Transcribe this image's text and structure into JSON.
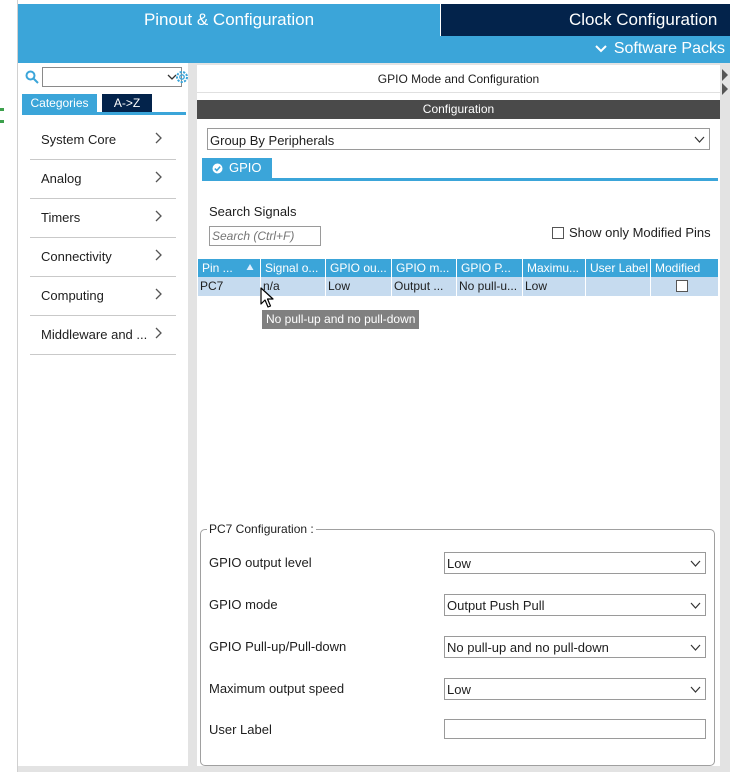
{
  "top_tabs": {
    "pinout_label": "Pinout & Configuration",
    "clock_label": "Clock Configuration",
    "software_packs": "Software Packs"
  },
  "left": {
    "search_placeholder": "",
    "tab_categories": "Categories",
    "tab_az": "A->Z",
    "categories": [
      {
        "label": "System Core"
      },
      {
        "label": "Analog"
      },
      {
        "label": "Timers"
      },
      {
        "label": "Connectivity"
      },
      {
        "label": "Computing"
      },
      {
        "label": "Middleware and ..."
      }
    ]
  },
  "main": {
    "title": "GPIO Mode and Configuration",
    "config_bar": "Configuration",
    "group_by": "Group By Peripherals",
    "gpio_tab": "GPIO",
    "search_label": "Search Signals",
    "search_placeholder": "Search (Ctrl+F)",
    "show_modified": "Show only Modified Pins",
    "table": {
      "headers": [
        "Pin ...",
        "Signal o...",
        "GPIO ou...",
        "GPIO m...",
        "GPIO P...",
        "Maximu...",
        "User Label",
        "Modified"
      ],
      "rows": [
        [
          "PC7",
          "n/a",
          "Low",
          "Output ...",
          "No pull-u...",
          "Low",
          "",
          ""
        ]
      ]
    },
    "tooltip": "No pull-up and no pull-down",
    "pc7_config": {
      "legend": "PC7 Configuration :",
      "fields": [
        {
          "label": "GPIO output level",
          "value": "Low"
        },
        {
          "label": "GPIO mode",
          "value": "Output Push Pull"
        },
        {
          "label": "GPIO Pull-up/Pull-down",
          "value": "No pull-up and no pull-down"
        },
        {
          "label": "Maximum output speed",
          "value": "Low"
        },
        {
          "label": "User Label",
          "value": ""
        }
      ]
    }
  },
  "colors": {
    "accent": "#3ba5d9",
    "dark_navy": "#03234b",
    "row_selected": "#c6dbef",
    "config_bar": "#4a4a4a"
  }
}
